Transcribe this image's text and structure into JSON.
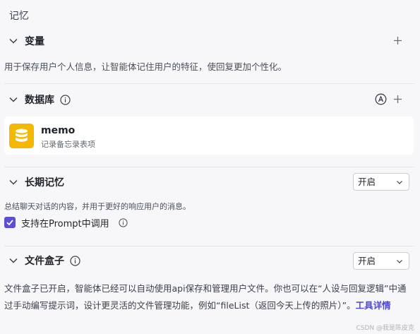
{
  "memory": {
    "title": "记忆"
  },
  "variables": {
    "label": "变量",
    "description": "用于保存用户个人信息，让智能体记住用户的特征，使回复更加个性化。"
  },
  "database": {
    "label": "数据库",
    "item": {
      "name": "memo",
      "description": "记录备忘录表项"
    }
  },
  "long_term_memory": {
    "label": "长期记忆",
    "select_value": "开启",
    "description": "总结聊天对话的内容，并用于更好的响应用户的消息。",
    "checkbox_label": "支持在Prompt中调用"
  },
  "file_box": {
    "label": "文件盒子",
    "select_value": "开启",
    "paragraph": "文件盒子已开启，智能体已经可以自动使用api保存和管理用户文件。你也可以在“人设与回复逻辑”中通过手动编写提示词，设计更灵活的文件管理功能，例如“fileList（返回今天上传的照片）”。",
    "link_label": "工具详情"
  },
  "watermark": "CSDN @我是陈皮克",
  "colors": {
    "accent": "#5a4fd6",
    "link": "#4e47d9",
    "db_icon": "#f5b800"
  }
}
